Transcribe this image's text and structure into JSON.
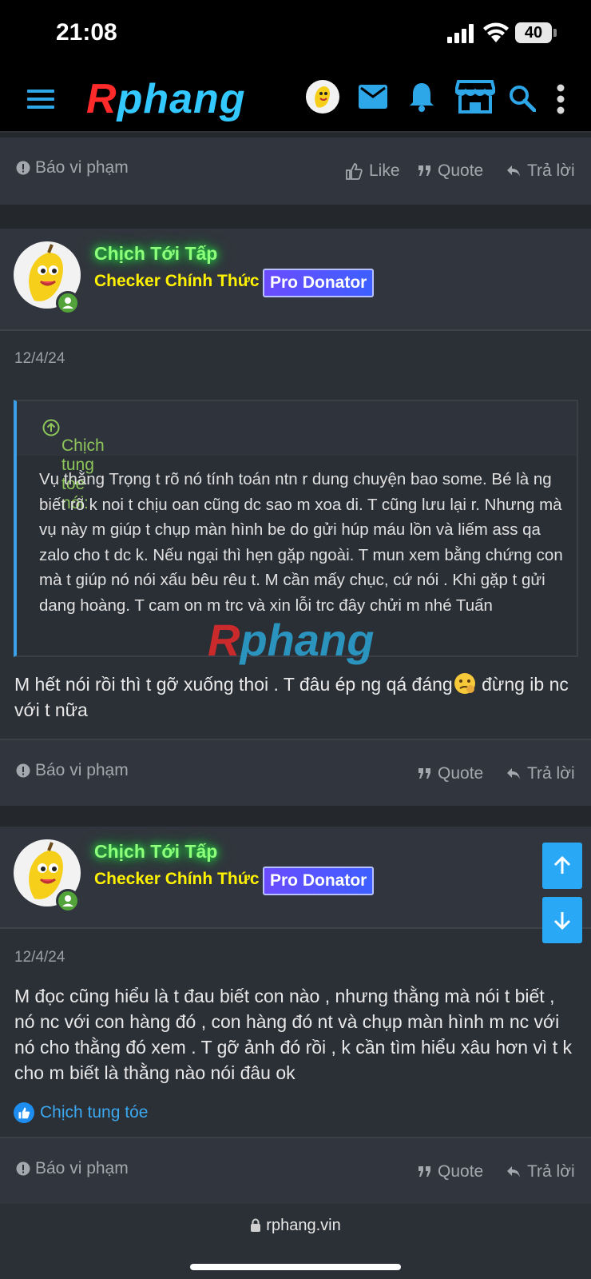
{
  "status": {
    "time": "21:08",
    "battery": "40"
  },
  "site": {
    "logo_r": "R",
    "logo_rest": "phang",
    "url": "rphang.vin"
  },
  "actions": {
    "report": "Báo vi phạm",
    "like": "Like",
    "quote": "Quote",
    "reply": "Trả lời"
  },
  "posts": [
    {
      "username": "Chịch Tới Tấp",
      "user_title": "Checker Chính Thức",
      "badge": "Pro Donator",
      "date": "12/4/24",
      "quote_author": "Chịch tung tóe nói:",
      "quote_text": "Vụ thằng Trọng t rõ nó tính toán ntn r dung chuyện bao some. Bé là ng biết rõ k noi t chịu oan cũng dc sao m xoa di. T cũng lưu lại r. Nhưng mà vụ này m giúp t chụp màn hình be do gửi húp máu lồn và liếm ass qa zalo cho t dc k. Nếu ngại thì hẹn gặp ngoài. T mun xem bằng chứng con mà t giúp nó nói xấu bêu rêu t. M cần mấy chục, cứ nói . Khi gặp t gửi dang hoàng. T cam on m trc và xin lỗi trc đây chửi m nhé Tuấn",
      "text_before_emoji": "M hết nói rồi thì t gỡ xuống thoi . T đâu ép ng qá đáng",
      "text_after_emoji": " đừng ib nc với t nữa"
    },
    {
      "username": "Chịch Tới Tấp",
      "user_title": "Checker Chính Thức",
      "badge": "Pro Donator",
      "date": "12/4/24",
      "text": "M đọc cũng hiểu là t đau biết con nào , nhưng thằng mà nói t biết , nó nc với con hàng đó , con hàng đó nt và chụp màn hình m nc với nó cho thằng đó xem . T gỡ ảnh đó rồi , k cần tìm hiểu xâu hơn vì t k cho m biết là thằng nào nói đâu ok",
      "liked_by": "Chịch tung tóe"
    }
  ],
  "icons": [
    "menu-icon",
    "envelope-icon",
    "bell-icon",
    "store-icon",
    "search-icon",
    "more-vertical-icon",
    "alert-icon",
    "thumbs-up-icon",
    "quote-icon",
    "reply-icon",
    "arrow-up-icon",
    "arrow-down-icon",
    "lock-icon"
  ]
}
